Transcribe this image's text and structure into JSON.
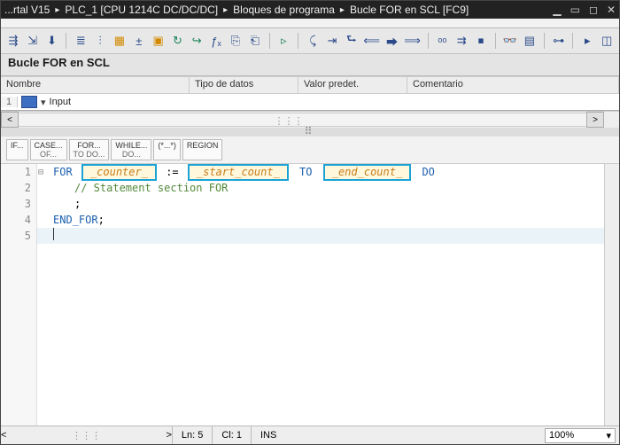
{
  "title": {
    "portal": "...rtal V15",
    "plc": "PLC_1 [CPU 1214C DC/DC/DC]",
    "folder": "Bloques de programa",
    "block": "Bucle FOR en SCL [FC9]"
  },
  "function_title": "Bucle FOR en SCL",
  "grid": {
    "headers": {
      "name": "Nombre",
      "type": "Tipo de datos",
      "def": "Valor predet.",
      "comment": "Comentario"
    },
    "row1": {
      "num": "1",
      "label": "Input"
    }
  },
  "sclbar": {
    "if": "IF...",
    "case_top": "CASE...",
    "case_bot": "OF...",
    "for_top": "FOR...",
    "for_bot": "TO DO...",
    "while_top": "WHILE...",
    "while_bot": "DO...",
    "comment": "(*...*)",
    "region": "REGION"
  },
  "code": {
    "for_kw": "FOR",
    "counter": "_counter_",
    "assign": ":=",
    "start": "_start_count_",
    "to_kw": "TO",
    "end": "_end_count_",
    "do_kw": "DO",
    "stmt": "// Statement section FOR",
    "semi": ";",
    "endfor": "END_FOR",
    "lines": [
      "1",
      "2",
      "3",
      "4",
      "5"
    ]
  },
  "status": {
    "ln": "Ln: 5",
    "cl": "Cl: 1",
    "ins": "INS",
    "zoom": "100%"
  }
}
